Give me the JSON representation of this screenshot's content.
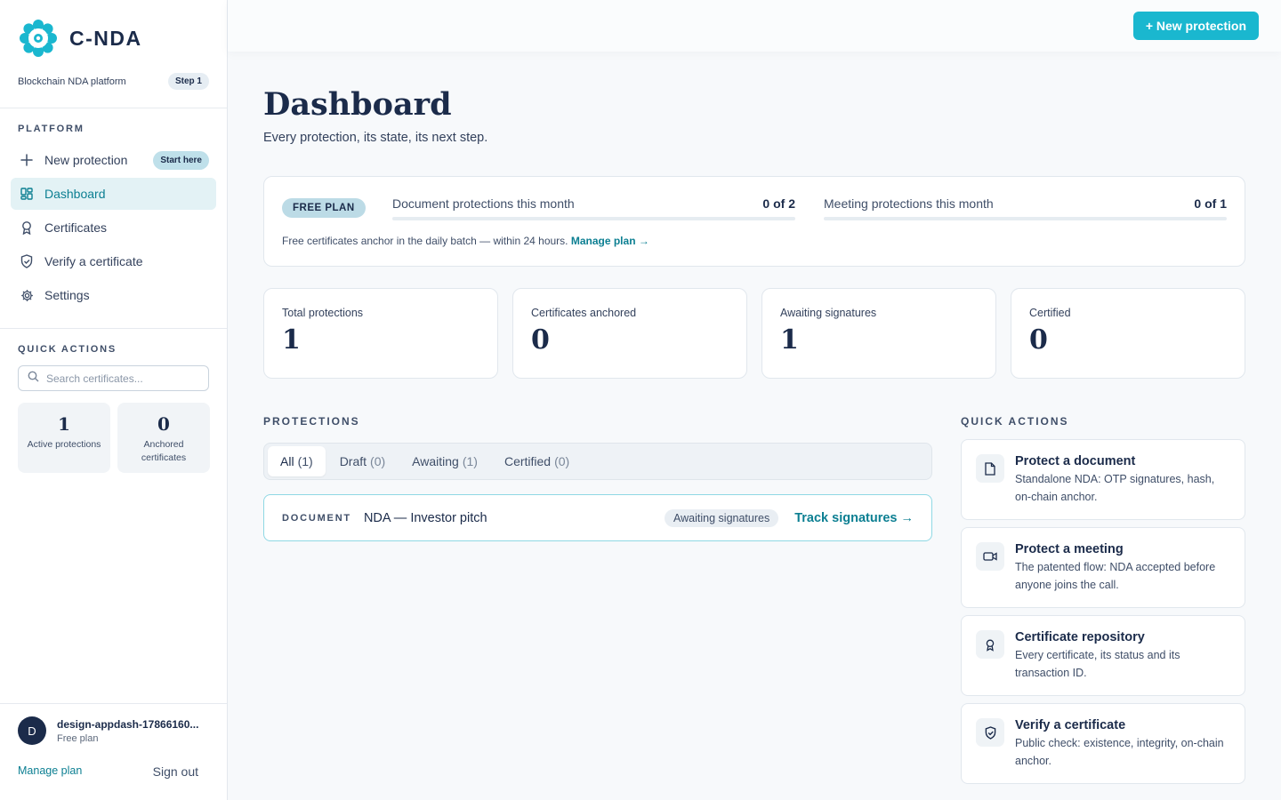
{
  "colors": {
    "accent": "#1ab7cf",
    "accent_text": "#0c7f92",
    "navy": "#1b2b4a"
  },
  "brand": {
    "name": "C-NDA",
    "tagline": "Blockchain NDA platform",
    "step": "Step 1",
    "logo_icon": "flower-logo-icon"
  },
  "sidebar": {
    "platform_label": "PLATFORM",
    "nav": [
      {
        "label": "New protection",
        "icon": "plus-icon",
        "badge": "Start here"
      },
      {
        "label": "Dashboard",
        "icon": "grid-icon",
        "active": true
      },
      {
        "label": "Certificates",
        "icon": "ribbon-icon"
      },
      {
        "label": "Verify a certificate",
        "icon": "shield-check-icon"
      },
      {
        "label": "Settings",
        "icon": "gear-icon"
      }
    ],
    "quick_label": "QUICK ACTIONS",
    "search_placeholder": "Search certificates...",
    "mini_stats": [
      {
        "value": "1",
        "label": "Active protections"
      },
      {
        "value": "0",
        "label": "Anchored certificates"
      }
    ],
    "user": {
      "initial": "D",
      "name": "design-appdash-17866160...",
      "plan": "Free plan"
    },
    "manage_plan": "Manage plan",
    "sign_out": "Sign out"
  },
  "topbar": {
    "new_button": "+ New protection"
  },
  "page": {
    "title": "Dashboard",
    "subtitle": "Every protection, its state, its next step."
  },
  "plan": {
    "badge": "FREE PLAN",
    "meters": [
      {
        "label": "Document protections this month",
        "value": "0 of 2",
        "fraction": 0
      },
      {
        "label": "Meeting protections this month",
        "value": "0 of 1",
        "fraction": 0
      }
    ],
    "note": "Free certificates anchor in the daily batch — within 24 hours.",
    "note_link": "Manage plan →"
  },
  "stats": [
    {
      "label": "Total protections",
      "value": "1"
    },
    {
      "label": "Certificates anchored",
      "value": "0"
    },
    {
      "label": "Awaiting signatures",
      "value": "1"
    },
    {
      "label": "Certified",
      "value": "0"
    }
  ],
  "protections": {
    "label": "PROTECTIONS",
    "tabs": [
      {
        "label": "All",
        "count": "(1)",
        "active": true
      },
      {
        "label": "Draft",
        "count": "(0)"
      },
      {
        "label": "Awaiting",
        "count": "(1)"
      },
      {
        "label": "Certified",
        "count": "(0)"
      }
    ],
    "rows": [
      {
        "type": "DOCUMENT",
        "title": "NDA — Investor pitch",
        "status": "Awaiting signatures",
        "action": "Track signatures →"
      }
    ]
  },
  "quick_actions": {
    "label": "QUICK ACTIONS",
    "items": [
      {
        "title": "Protect a document",
        "desc": "Standalone NDA: OTP signatures, hash, on-chain anchor.",
        "icon": "document-icon"
      },
      {
        "title": "Protect a meeting",
        "desc": "The patented flow: NDA accepted before anyone joins the call.",
        "icon": "video-icon"
      },
      {
        "title": "Certificate repository",
        "desc": "Every certificate, its status and its transaction ID.",
        "icon": "ribbon-icon"
      },
      {
        "title": "Verify a certificate",
        "desc": "Public check: existence, integrity, on-chain anchor.",
        "icon": "shield-check-icon"
      }
    ]
  }
}
